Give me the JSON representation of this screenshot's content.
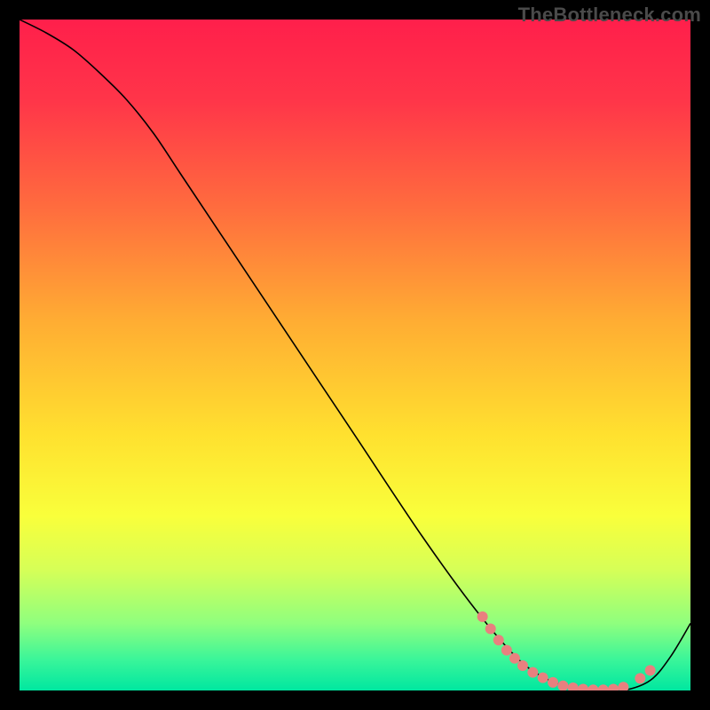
{
  "watermark": "TheBottleneck.com",
  "chart_data": {
    "type": "line",
    "title": "",
    "xlabel": "",
    "ylabel": "",
    "xlim": [
      0,
      100
    ],
    "ylim": [
      0,
      100
    ],
    "grid": false,
    "legend": false,
    "background": {
      "type": "vertical-gradient",
      "stops": [
        {
          "pos": 0.0,
          "color": "#ff1f4b"
        },
        {
          "pos": 0.12,
          "color": "#ff3549"
        },
        {
          "pos": 0.28,
          "color": "#ff6c3e"
        },
        {
          "pos": 0.45,
          "color": "#ffad33"
        },
        {
          "pos": 0.62,
          "color": "#ffe12f"
        },
        {
          "pos": 0.74,
          "color": "#f9ff3b"
        },
        {
          "pos": 0.82,
          "color": "#d6ff57"
        },
        {
          "pos": 0.9,
          "color": "#8fff7e"
        },
        {
          "pos": 0.955,
          "color": "#39f59a"
        },
        {
          "pos": 1.0,
          "color": "#00e7a0"
        }
      ]
    },
    "series": [
      {
        "name": "curve",
        "color": "#000000",
        "stroke_width": 1.6,
        "x": [
          0,
          4,
          8,
          12,
          16,
          20,
          24,
          30,
          40,
          50,
          60,
          68,
          74,
          78,
          82,
          86,
          90,
          94,
          97,
          100
        ],
        "y": [
          100,
          98,
          95.5,
          92,
          88,
          83,
          77,
          68,
          53,
          38,
          23,
          12,
          5,
          2,
          0.5,
          0,
          0,
          1.5,
          5,
          10
        ]
      }
    ],
    "markers": {
      "name": "highlight-dots",
      "color": "#e9807f",
      "radius": 6,
      "points": [
        {
          "x": 69.0,
          "y": 11.0
        },
        {
          "x": 70.2,
          "y": 9.2
        },
        {
          "x": 71.4,
          "y": 7.5
        },
        {
          "x": 72.6,
          "y": 6.0
        },
        {
          "x": 73.8,
          "y": 4.8
        },
        {
          "x": 75.0,
          "y": 3.7
        },
        {
          "x": 76.5,
          "y": 2.7
        },
        {
          "x": 78.0,
          "y": 1.9
        },
        {
          "x": 79.5,
          "y": 1.2
        },
        {
          "x": 81.0,
          "y": 0.7
        },
        {
          "x": 82.5,
          "y": 0.4
        },
        {
          "x": 84.0,
          "y": 0.2
        },
        {
          "x": 85.5,
          "y": 0.1
        },
        {
          "x": 87.0,
          "y": 0.1
        },
        {
          "x": 88.5,
          "y": 0.2
        },
        {
          "x": 90.0,
          "y": 0.5
        },
        {
          "x": 92.5,
          "y": 1.8
        },
        {
          "x": 94.0,
          "y": 3.0
        }
      ]
    }
  }
}
